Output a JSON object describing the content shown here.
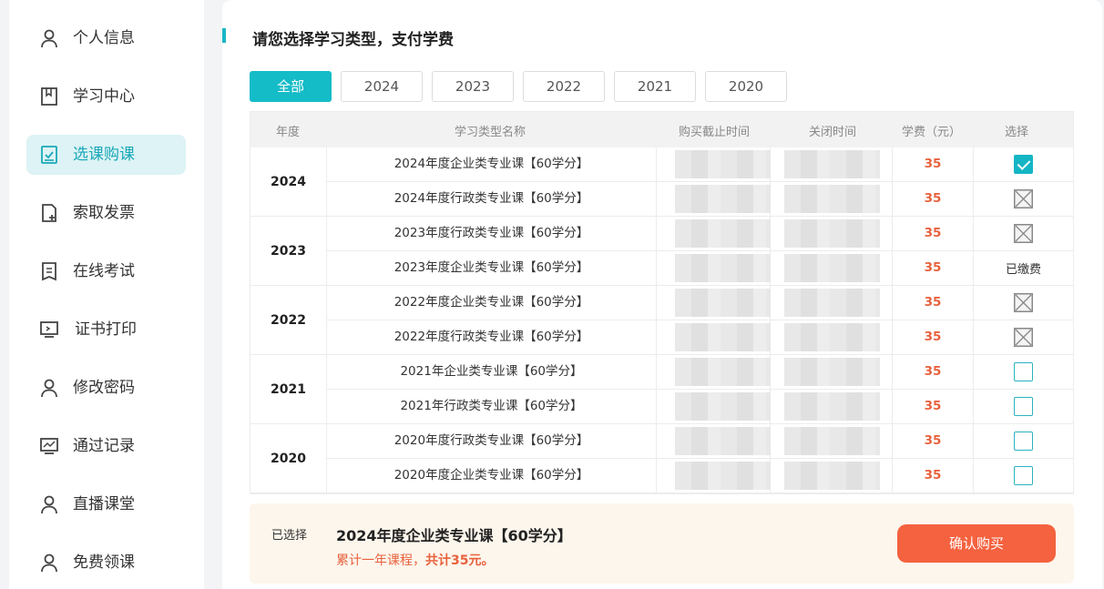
{
  "sidebar": {
    "items": [
      {
        "label": "个人信息",
        "icon": "user-icon"
      },
      {
        "label": "学习中心",
        "icon": "book-icon"
      },
      {
        "label": "选课购课",
        "icon": "checkbox-icon",
        "active": true
      },
      {
        "label": "索取发票",
        "icon": "file-add-icon"
      },
      {
        "label": "在线考试",
        "icon": "exam-doc-icon"
      },
      {
        "label": "证书打印",
        "icon": "monitor-icon"
      },
      {
        "label": "修改密码",
        "icon": "user-icon"
      },
      {
        "label": "通过记录",
        "icon": "chart-icon"
      },
      {
        "label": "直播课堂",
        "icon": "user-icon"
      },
      {
        "label": "免费领课",
        "icon": "user-icon"
      }
    ]
  },
  "main": {
    "title": "请您选择学习类型，支付学费",
    "tabs": [
      "全部",
      "2024",
      "2023",
      "2022",
      "2021",
      "2020"
    ],
    "active_tab": "全部"
  },
  "table": {
    "headers": [
      "年度",
      "学习类型名称",
      "购买截止时间",
      "关闭时间",
      "学费（元）",
      "选择"
    ],
    "groups": [
      {
        "year": "2024",
        "rows": [
          {
            "name": "2024年度企业类专业课【60学分】",
            "fee": "35",
            "select": "checked"
          },
          {
            "name": "2024年度行政类专业课【60学分】",
            "fee": "35",
            "select": "disabled"
          }
        ]
      },
      {
        "year": "2023",
        "rows": [
          {
            "name": "2023年度行政类专业课【60学分】",
            "fee": "35",
            "select": "disabled"
          },
          {
            "name": "2023年度企业类专业课【60学分】",
            "fee": "35",
            "select": "paid",
            "select_text": "已缴费"
          }
        ]
      },
      {
        "year": "2022",
        "rows": [
          {
            "name": "2022年度企业类专业课【60学分】",
            "fee": "35",
            "select": "disabled"
          },
          {
            "name": "2022年度行政类专业课【60学分】",
            "fee": "35",
            "select": "disabled"
          }
        ]
      },
      {
        "year": "2021",
        "rows": [
          {
            "name": "2021年企业类专业课【60学分】",
            "fee": "35",
            "select": "unchecked"
          },
          {
            "name": "2021年行政类专业课【60学分】",
            "fee": "35",
            "select": "unchecked"
          }
        ]
      },
      {
        "year": "2020",
        "rows": [
          {
            "name": "2020年度行政类专业课【60学分】",
            "fee": "35",
            "select": "unchecked"
          },
          {
            "name": "2020年度企业类专业课【60学分】",
            "fee": "35",
            "select": "unchecked"
          }
        ]
      }
    ]
  },
  "summary": {
    "label": "已选择",
    "course": "2024年度企业类专业课【60学分】",
    "total_prefix": "累计一年课程，",
    "total_bold": "共计35元。",
    "button": "确认购买"
  },
  "colors": {
    "accent": "#14bcc8",
    "fee": "#e8613d",
    "buy_button": "#f4623f",
    "summary_bg": "#fdf6ec"
  }
}
